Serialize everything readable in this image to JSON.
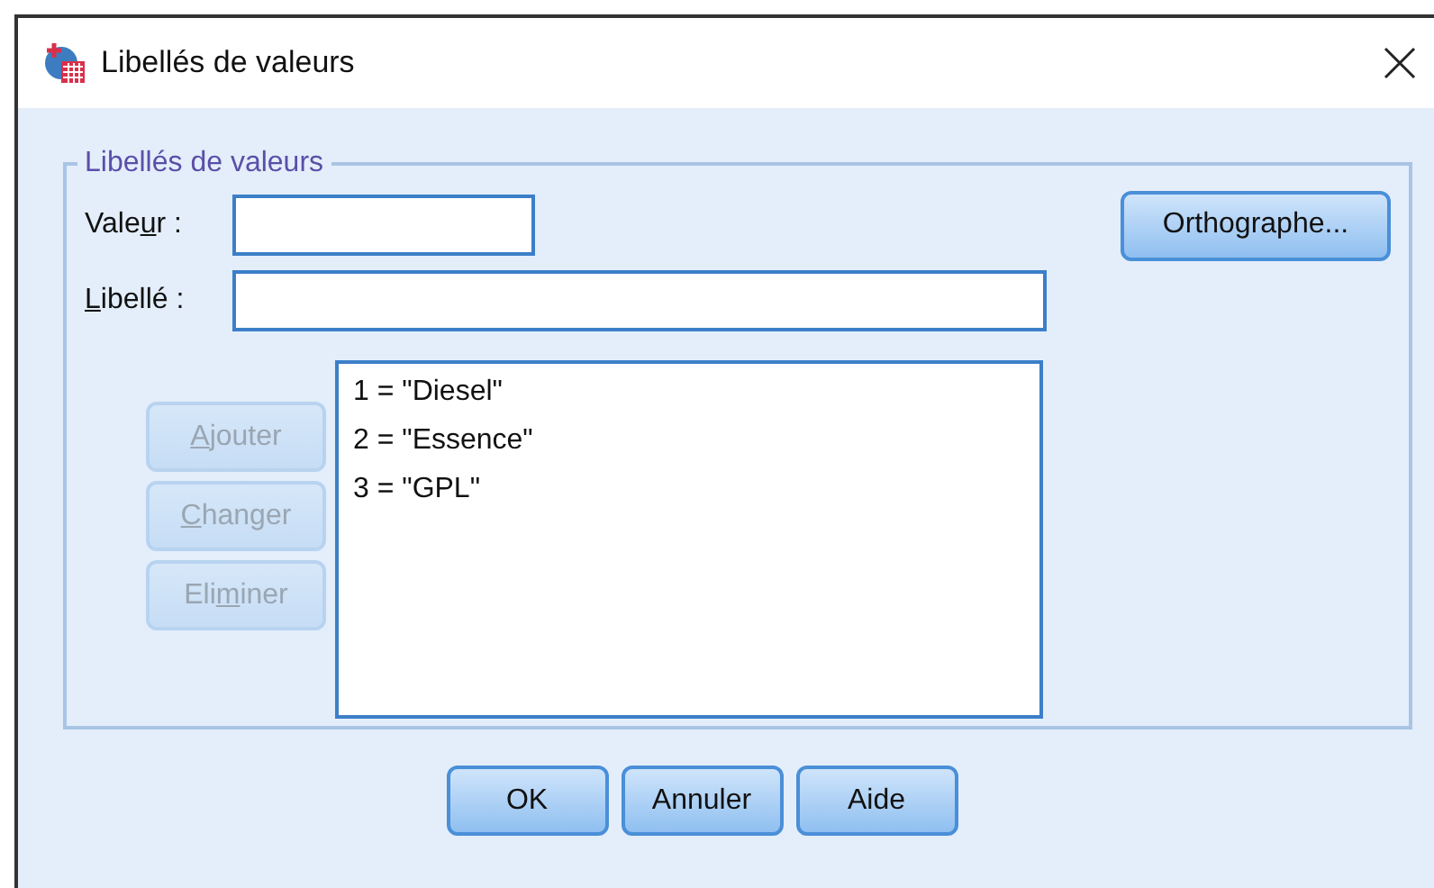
{
  "window": {
    "title": "Libellés de valeurs"
  },
  "group": {
    "title": "Libellés de valeurs"
  },
  "fields": [
    {
      "label": {
        "before": "Vale",
        "key": "u",
        "after": "r :"
      },
      "kind": "short"
    },
    {
      "label": {
        "key": "L",
        "after": "ibellé :"
      },
      "kind": "wide"
    }
  ],
  "spell_button": {
    "label": "Orthographe...",
    "disabled": false
  },
  "side_buttons": [
    {
      "label": {
        "key": "A",
        "after": "jouter"
      },
      "disabled": true
    },
    {
      "label": {
        "key": "C",
        "after": "hanger"
      },
      "disabled": true
    },
    {
      "label": {
        "before": "Eli",
        "key": "m",
        "after": "iner"
      },
      "disabled": true
    }
  ],
  "list_items": [
    {
      "text": "1 = \"Diesel\"",
      "selected": false
    },
    {
      "text": "2 = \"Essence\"",
      "selected": false
    },
    {
      "text": "3 = \"GPL\"",
      "selected": false
    }
  ],
  "buttons": [
    {
      "label": "OK",
      "disabled": false
    },
    {
      "label": "Annuler",
      "disabled": false
    },
    {
      "label": "Aide",
      "disabled": false
    }
  ]
}
